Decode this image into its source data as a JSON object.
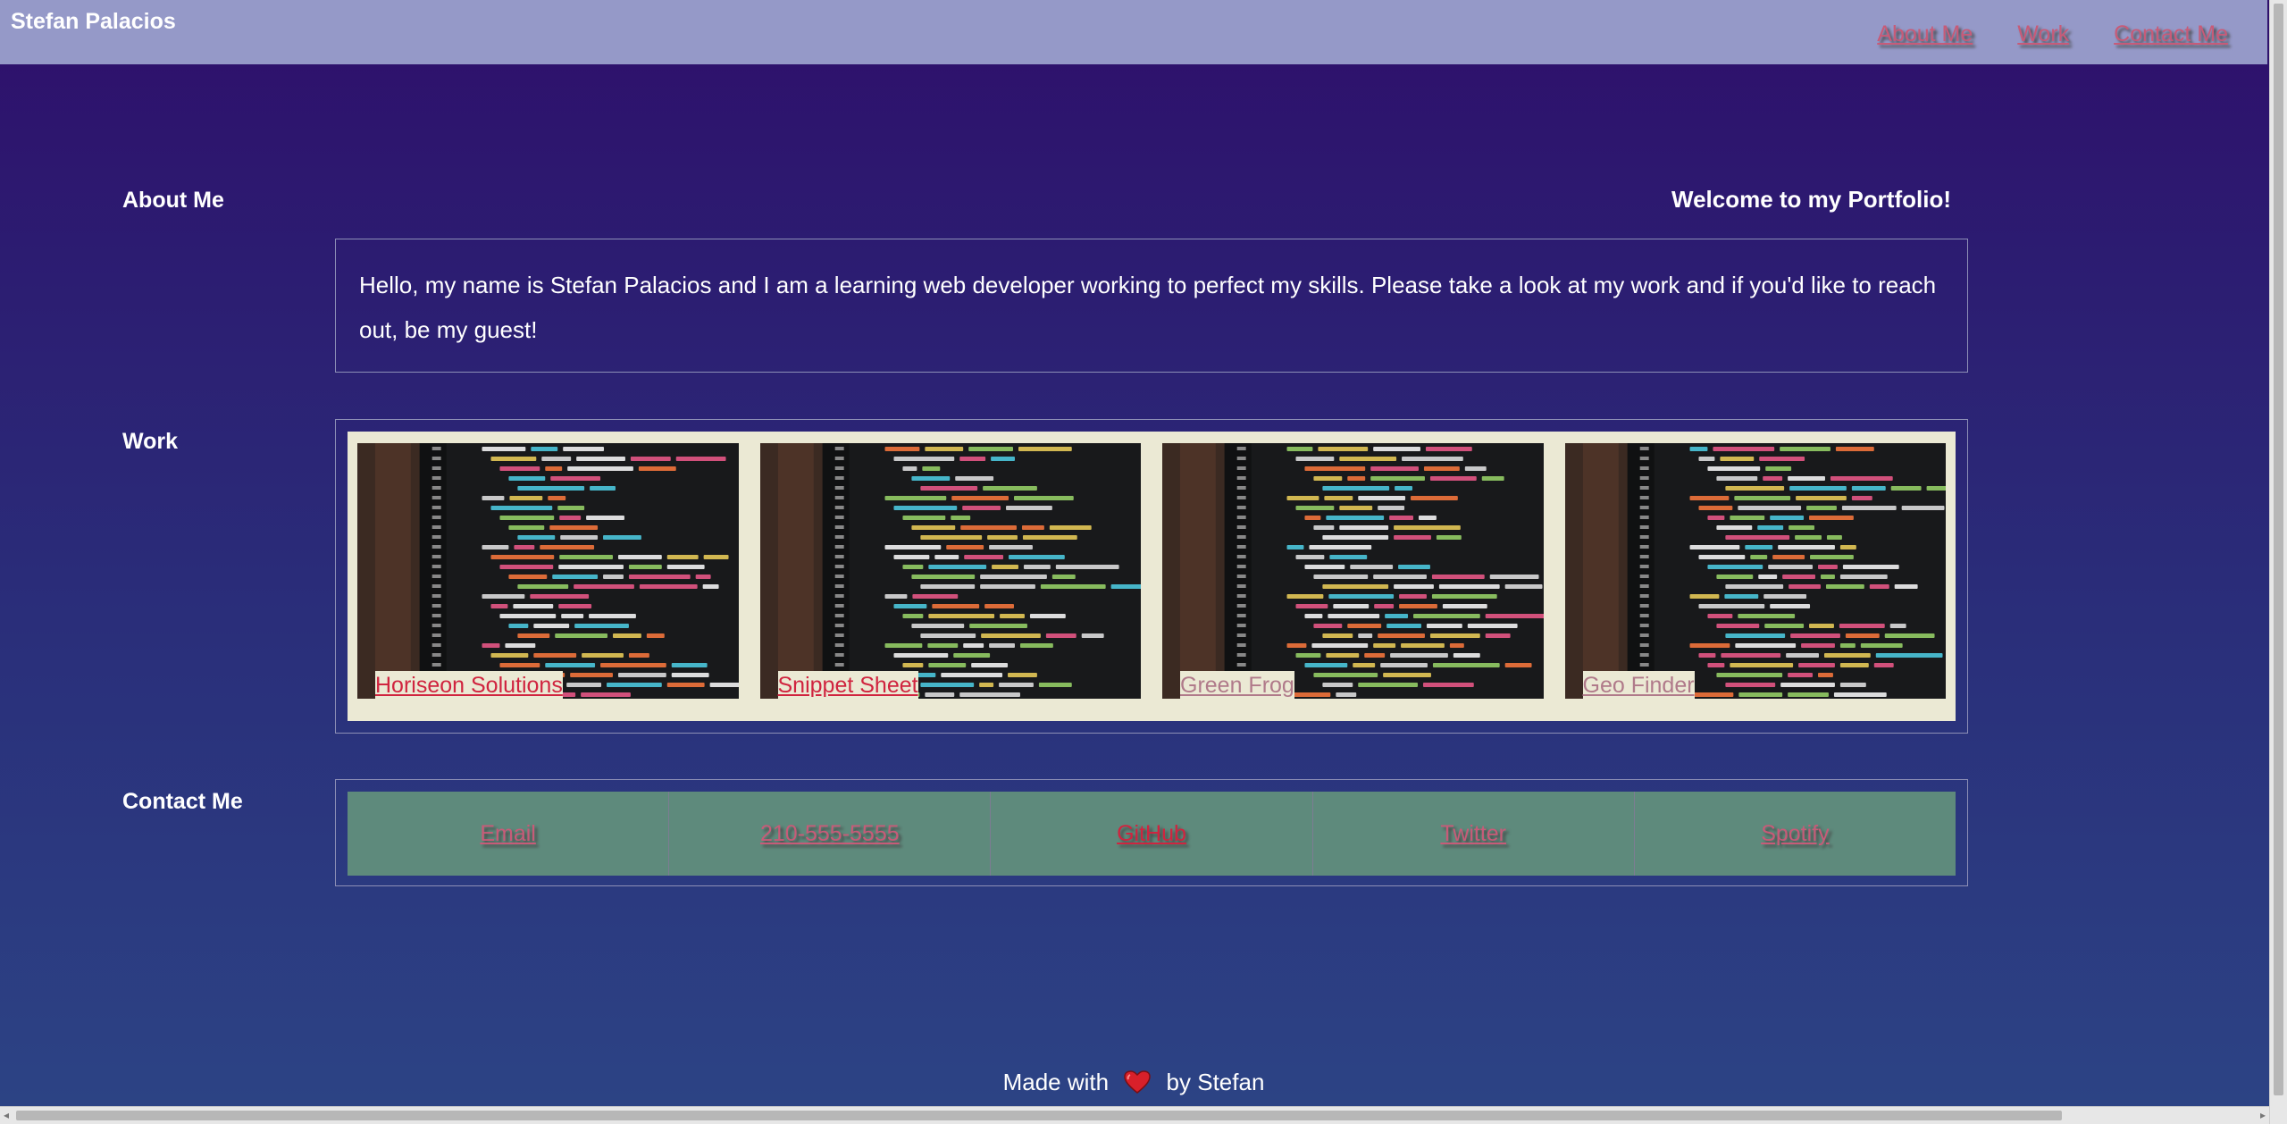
{
  "header": {
    "brand": "Stefan Palacios",
    "nav": [
      "About Me",
      "Work",
      "Contact Me"
    ]
  },
  "about": {
    "title": "About Me",
    "welcome": "Welcome to my Portfolio!",
    "text": "Hello, my name is Stefan Palacios and I am a learning web developer working to perfect my skills. Please take a look at my work and if you'd like to reach out, be my guest!"
  },
  "work": {
    "title": "Work",
    "projects": [
      {
        "name": "Horiseon Solutions",
        "link_color": "#d0243f"
      },
      {
        "name": "Snippet Sheet",
        "link_color": "#d0243f"
      },
      {
        "name": "Green Frog",
        "link_color": "#b07a8a"
      },
      {
        "name": "Geo Finder",
        "link_color": "#b07a8a"
      }
    ]
  },
  "contact": {
    "title": "Contact Me",
    "items": [
      "Email",
      "210-555-5555",
      "GitHub",
      "Twitter",
      "Spotify"
    ]
  },
  "footer": {
    "before": "Made with",
    "icon": "heart-icon",
    "after": "by Stefan"
  },
  "colors": {
    "topbar": "#9599c8",
    "nav_link": "#c75b78",
    "contact_bg": "#5e8a7c",
    "work_bg": "#ebe9d4",
    "heart": "#d8202a"
  }
}
